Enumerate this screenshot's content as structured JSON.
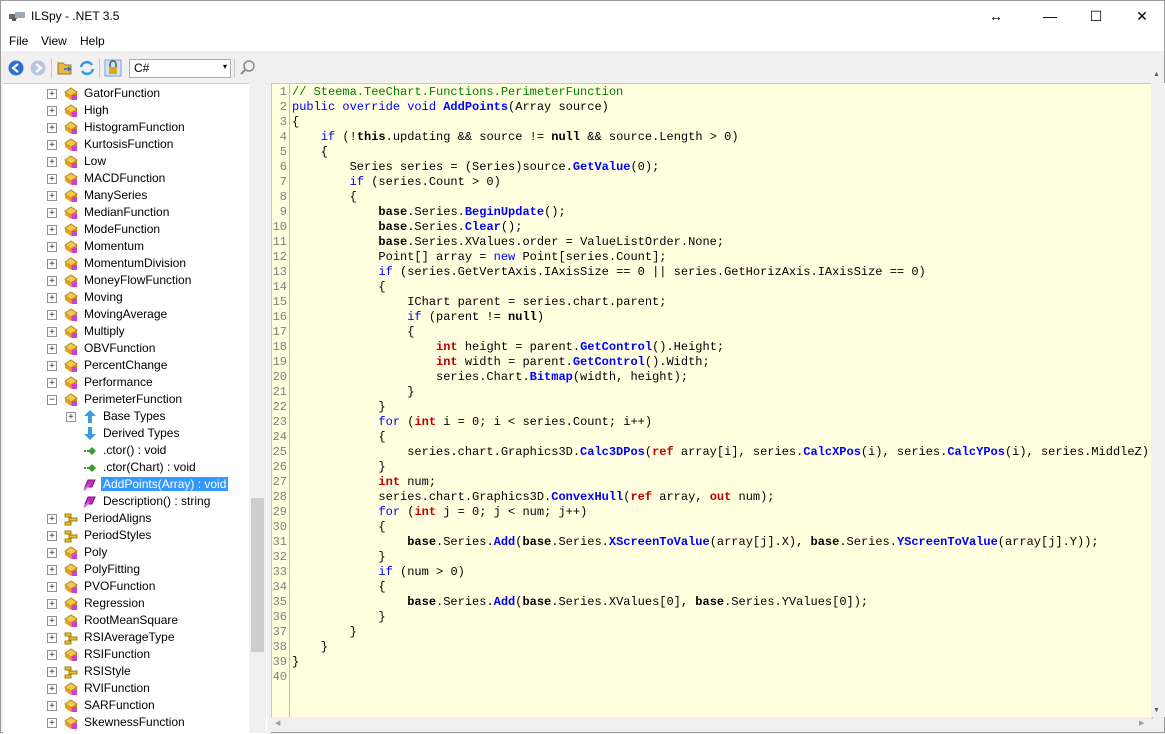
{
  "window": {
    "title": "ILSpy - .NET 3.5",
    "resize_glyph": "↔",
    "minimize_glyph": "—",
    "maximize_glyph": "☐",
    "close_glyph": "✕"
  },
  "menu": {
    "items": [
      "File",
      "View",
      "Help"
    ]
  },
  "toolbar": {
    "language": "C#",
    "language_arrow": "▾",
    "search_icon": "search-icon",
    "scroll_up": "▲",
    "scroll_down": "▼",
    "scroll_left": "◀",
    "scroll_right": "▶"
  },
  "tree": {
    "items": [
      {
        "label": "GatorFunction",
        "icon": "class-icon",
        "expander": "+"
      },
      {
        "label": "High",
        "icon": "class-icon",
        "expander": "+"
      },
      {
        "label": "HistogramFunction",
        "icon": "class-icon",
        "expander": "+"
      },
      {
        "label": "KurtosisFunction",
        "icon": "class-icon",
        "expander": "+"
      },
      {
        "label": "Low",
        "icon": "class-icon",
        "expander": "+"
      },
      {
        "label": "MACDFunction",
        "icon": "class-icon",
        "expander": "+"
      },
      {
        "label": "ManySeries",
        "icon": "class-icon",
        "expander": "+"
      },
      {
        "label": "MedianFunction",
        "icon": "class-icon",
        "expander": "+"
      },
      {
        "label": "ModeFunction",
        "icon": "class-icon",
        "expander": "+"
      },
      {
        "label": "Momentum",
        "icon": "class-icon",
        "expander": "+"
      },
      {
        "label": "MomentumDivision",
        "icon": "class-icon",
        "expander": "+"
      },
      {
        "label": "MoneyFlowFunction",
        "icon": "class-icon",
        "expander": "+"
      },
      {
        "label": "Moving",
        "icon": "class-icon",
        "expander": "+"
      },
      {
        "label": "MovingAverage",
        "icon": "class-icon",
        "expander": "+"
      },
      {
        "label": "Multiply",
        "icon": "class-icon",
        "expander": "+"
      },
      {
        "label": "OBVFunction",
        "icon": "class-icon",
        "expander": "+"
      },
      {
        "label": "PercentChange",
        "icon": "class-icon",
        "expander": "+"
      },
      {
        "label": "Performance",
        "icon": "class-icon",
        "expander": "+"
      },
      {
        "label": "PerimeterFunction",
        "icon": "class-icon",
        "expander": "−"
      },
      {
        "label": "Base Types",
        "icon": "base-types-icon",
        "expander": "+",
        "child": true
      },
      {
        "label": "Derived Types",
        "icon": "derived-types-icon",
        "expander": "",
        "child": true
      },
      {
        "label": ".ctor() : void",
        "icon": "constructor-icon",
        "expander": "",
        "child": true
      },
      {
        "label": ".ctor(Chart) : void",
        "icon": "constructor-icon",
        "expander": "",
        "child": true
      },
      {
        "label": "AddPoints(Array) : void",
        "icon": "method-override-icon",
        "expander": "",
        "child": true,
        "selected": true
      },
      {
        "label": "Description() : string",
        "icon": "method-override-icon",
        "expander": "",
        "child": true
      },
      {
        "label": "PeriodAligns",
        "icon": "enum-icon",
        "expander": "+"
      },
      {
        "label": "PeriodStyles",
        "icon": "enum-icon",
        "expander": "+"
      },
      {
        "label": "Poly",
        "icon": "class-icon",
        "expander": "+"
      },
      {
        "label": "PolyFitting",
        "icon": "class-icon",
        "expander": "+"
      },
      {
        "label": "PVOFunction",
        "icon": "class-icon",
        "expander": "+"
      },
      {
        "label": "Regression",
        "icon": "class-icon",
        "expander": "+"
      },
      {
        "label": "RootMeanSquare",
        "icon": "class-icon",
        "expander": "+"
      },
      {
        "label": "RSIAverageType",
        "icon": "enum-icon",
        "expander": "+"
      },
      {
        "label": "RSIFunction",
        "icon": "class-icon",
        "expander": "+"
      },
      {
        "label": "RSIStyle",
        "icon": "enum-icon",
        "expander": "+"
      },
      {
        "label": "RVIFunction",
        "icon": "class-icon",
        "expander": "+"
      },
      {
        "label": "SARFunction",
        "icon": "class-icon",
        "expander": "+"
      },
      {
        "label": "SkewnessFunction",
        "icon": "class-icon",
        "expander": "+"
      }
    ]
  },
  "code": {
    "lines": [
      [
        [
          "cm",
          "// Steema.TeeChart.Functions.PerimeterFunction"
        ]
      ],
      [
        [
          "kw",
          "public override void "
        ],
        [
          "mt",
          "AddPoints"
        ],
        [
          "t",
          "(Array source)"
        ]
      ],
      [
        [
          "t",
          "{"
        ]
      ],
      [
        [
          "t",
          "    "
        ],
        [
          "kw",
          "if"
        ],
        [
          "t",
          " (!"
        ],
        [
          "kwb",
          "this"
        ],
        [
          "t",
          ".updating && source != "
        ],
        [
          "kwb",
          "null"
        ],
        [
          "t",
          " && source.Length > 0)"
        ]
      ],
      [
        [
          "t",
          "    {"
        ]
      ],
      [
        [
          "t",
          "        Series series = (Series)source."
        ],
        [
          "mt",
          "GetValue"
        ],
        [
          "t",
          "(0);"
        ]
      ],
      [
        [
          "t",
          "        "
        ],
        [
          "kw",
          "if"
        ],
        [
          "t",
          " (series.Count > 0)"
        ]
      ],
      [
        [
          "t",
          "        {"
        ]
      ],
      [
        [
          "t",
          "            "
        ],
        [
          "kwb",
          "base"
        ],
        [
          "t",
          ".Series."
        ],
        [
          "mt",
          "BeginUpdate"
        ],
        [
          "t",
          "();"
        ]
      ],
      [
        [
          "t",
          "            "
        ],
        [
          "kwb",
          "base"
        ],
        [
          "t",
          ".Series."
        ],
        [
          "mt",
          "Clear"
        ],
        [
          "t",
          "();"
        ]
      ],
      [
        [
          "t",
          "            "
        ],
        [
          "kwb",
          "base"
        ],
        [
          "t",
          ".Series.XValues.order = ValueListOrder.None;"
        ]
      ],
      [
        [
          "t",
          "            Point[] array = "
        ],
        [
          "kw",
          "new"
        ],
        [
          "t",
          " Point[series.Count];"
        ]
      ],
      [
        [
          "t",
          "            "
        ],
        [
          "kw",
          "if"
        ],
        [
          "t",
          " (series.GetVertAxis.IAxisSize == 0 || series.GetHorizAxis.IAxisSize == 0)"
        ]
      ],
      [
        [
          "t",
          "            {"
        ]
      ],
      [
        [
          "t",
          "                IChart parent = series.chart.parent;"
        ]
      ],
      [
        [
          "t",
          "                "
        ],
        [
          "kw",
          "if"
        ],
        [
          "t",
          " (parent != "
        ],
        [
          "kwb",
          "null"
        ],
        [
          "t",
          ")"
        ]
      ],
      [
        [
          "t",
          "                {"
        ]
      ],
      [
        [
          "t",
          "                    "
        ],
        [
          "ty",
          "int"
        ],
        [
          "t",
          " height = parent."
        ],
        [
          "mt",
          "GetControl"
        ],
        [
          "t",
          "().Height;"
        ]
      ],
      [
        [
          "t",
          "                    "
        ],
        [
          "ty",
          "int"
        ],
        [
          "t",
          " width = parent."
        ],
        [
          "mt",
          "GetControl"
        ],
        [
          "t",
          "().Width;"
        ]
      ],
      [
        [
          "t",
          "                    series.Chart."
        ],
        [
          "mt",
          "Bitmap"
        ],
        [
          "t",
          "(width, height);"
        ]
      ],
      [
        [
          "t",
          "                }"
        ]
      ],
      [
        [
          "t",
          "            }"
        ]
      ],
      [
        [
          "t",
          "            "
        ],
        [
          "kw",
          "for"
        ],
        [
          "t",
          " ("
        ],
        [
          "ty",
          "int"
        ],
        [
          "t",
          " i = 0; i < series.Count; i++)"
        ]
      ],
      [
        [
          "t",
          "            {"
        ]
      ],
      [
        [
          "t",
          "                series.chart.Graphics3D."
        ],
        [
          "mt",
          "Calc3DPos"
        ],
        [
          "t",
          "("
        ],
        [
          "ty",
          "ref"
        ],
        [
          "t",
          " array[i], series."
        ],
        [
          "mt",
          "CalcXPos"
        ],
        [
          "t",
          "(i), series."
        ],
        [
          "mt",
          "CalcYPos"
        ],
        [
          "t",
          "(i), series.MiddleZ);"
        ]
      ],
      [
        [
          "t",
          "            }"
        ]
      ],
      [
        [
          "t",
          "            "
        ],
        [
          "ty",
          "int"
        ],
        [
          "t",
          " num;"
        ]
      ],
      [
        [
          "t",
          "            series.chart.Graphics3D."
        ],
        [
          "mt",
          "ConvexHull"
        ],
        [
          "t",
          "("
        ],
        [
          "ty",
          "ref"
        ],
        [
          "t",
          " array, "
        ],
        [
          "ty",
          "out"
        ],
        [
          "t",
          " num);"
        ]
      ],
      [
        [
          "t",
          "            "
        ],
        [
          "kw",
          "for"
        ],
        [
          "t",
          " ("
        ],
        [
          "ty",
          "int"
        ],
        [
          "t",
          " j = 0; j < num; j++)"
        ]
      ],
      [
        [
          "t",
          "            {"
        ]
      ],
      [
        [
          "t",
          "                "
        ],
        [
          "kwb",
          "base"
        ],
        [
          "t",
          ".Series."
        ],
        [
          "mt",
          "Add"
        ],
        [
          "t",
          "("
        ],
        [
          "kwb",
          "base"
        ],
        [
          "t",
          ".Series."
        ],
        [
          "mt",
          "XScreenToValue"
        ],
        [
          "t",
          "(array[j].X), "
        ],
        [
          "kwb",
          "base"
        ],
        [
          "t",
          ".Series."
        ],
        [
          "mt",
          "YScreenToValue"
        ],
        [
          "t",
          "(array[j].Y));"
        ]
      ],
      [
        [
          "t",
          "            }"
        ]
      ],
      [
        [
          "t",
          "            "
        ],
        [
          "kw",
          "if"
        ],
        [
          "t",
          " (num > 0)"
        ]
      ],
      [
        [
          "t",
          "            {"
        ]
      ],
      [
        [
          "t",
          "                "
        ],
        [
          "kwb",
          "base"
        ],
        [
          "t",
          ".Series."
        ],
        [
          "mt",
          "Add"
        ],
        [
          "t",
          "("
        ],
        [
          "kwb",
          "base"
        ],
        [
          "t",
          ".Series.XValues[0], "
        ],
        [
          "kwb",
          "base"
        ],
        [
          "t",
          ".Series.YValues[0]);"
        ]
      ],
      [
        [
          "t",
          "            }"
        ]
      ],
      [
        [
          "t",
          "        }"
        ]
      ],
      [
        [
          "t",
          "    }"
        ]
      ],
      [
        [
          "t",
          "}"
        ]
      ],
      [
        [
          "t",
          ""
        ]
      ]
    ]
  }
}
